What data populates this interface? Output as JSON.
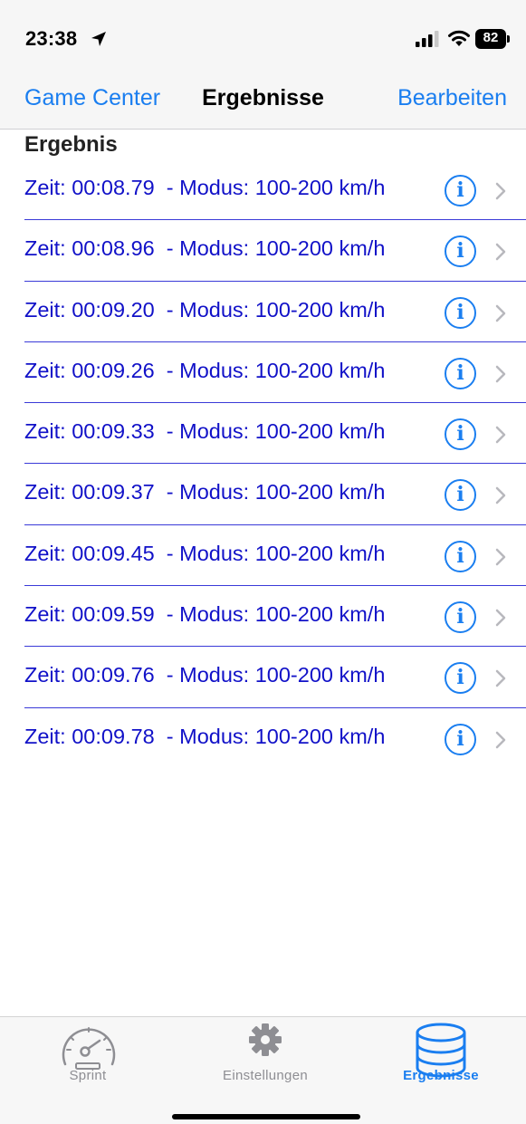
{
  "status": {
    "time": "23:38",
    "battery": "82"
  },
  "nav": {
    "left": "Game Center",
    "title": "Ergebnisse",
    "right": "Bearbeiten"
  },
  "section": "Ergebnis",
  "rows": [
    "Zeit: 00:08.79  - Modus: 100-200 km/h",
    "Zeit: 00:08.96  - Modus: 100-200 km/h",
    "Zeit: 00:09.20  - Modus: 100-200 km/h",
    "Zeit: 00:09.26  - Modus: 100-200 km/h",
    "Zeit: 00:09.33  - Modus: 100-200 km/h",
    "Zeit: 00:09.37  - Modus: 100-200 km/h",
    "Zeit: 00:09.45  - Modus: 100-200 km/h",
    "Zeit: 00:09.59  - Modus: 100-200 km/h",
    "Zeit: 00:09.76  - Modus: 100-200 km/h",
    "Zeit: 00:09.78  - Modus: 100-200 km/h"
  ],
  "info_glyph": "i",
  "tabs": [
    {
      "label": "Sprint",
      "icon": "speedometer-icon"
    },
    {
      "label": "Einstellungen",
      "icon": "gear-icon"
    },
    {
      "label": "Ergebnisse",
      "icon": "database-icon"
    }
  ],
  "colors": {
    "accent": "#1a7ef0",
    "row_text": "#1111c8",
    "separator": "#3a3ad8"
  }
}
